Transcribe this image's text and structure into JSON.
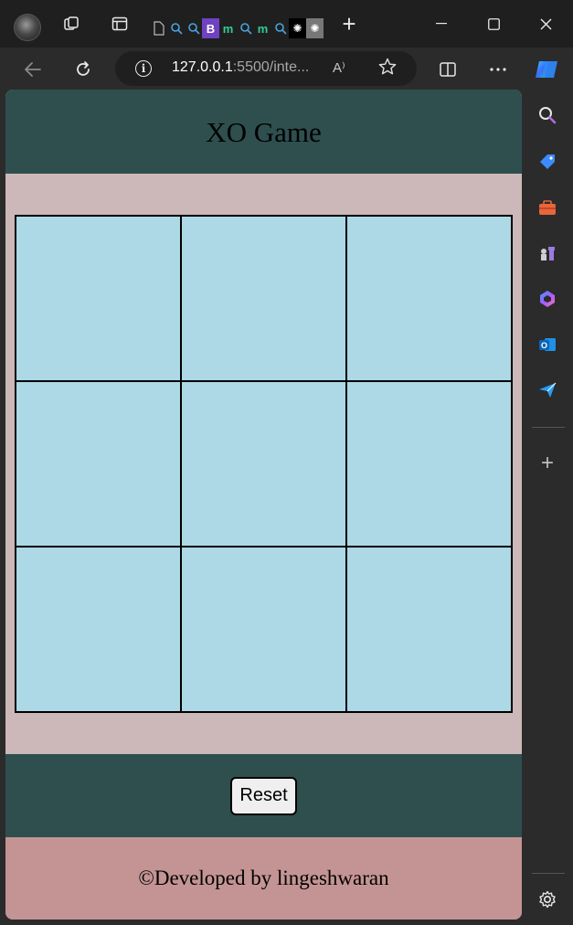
{
  "browser": {
    "url_host": "127.0.0.1",
    "url_rest": ":5500/inte...",
    "tab_favicons": [
      "page-icon",
      "search-icon",
      "search-icon",
      "b-icon",
      "m-icon",
      "search-icon",
      "m-icon",
      "search-icon",
      "openai-icon",
      "openai-icon"
    ],
    "tab_favicon_letters": [
      "▯",
      "⌕",
      "⌕",
      "B",
      "ᴍ",
      "⌕",
      "ᴍ",
      "⌕",
      "⚙",
      "⚙"
    ],
    "read_aloud_label": "A⁾",
    "window_controls": {
      "minimize": "—",
      "maximize": "☐",
      "close": "✕"
    }
  },
  "sidebar": {
    "items": [
      "search-icon",
      "tag-icon",
      "toolbox-icon",
      "chess-icon",
      "copilot-icon",
      "outlook-icon",
      "send-icon"
    ],
    "add_label": "+",
    "settings_label": "⚙"
  },
  "page": {
    "title": "XO Game",
    "board": {
      "cells": [
        "",
        "",
        "",
        "",
        "",
        "",
        "",
        "",
        ""
      ]
    },
    "reset_label": "Reset",
    "footer_text": "©Developed by lingeshwaran"
  },
  "colors": {
    "header_bg": "#2f4f4f",
    "page_bg": "#ccb8b8",
    "cell_bg": "#add8e6",
    "footer_bg": "#c49494"
  }
}
